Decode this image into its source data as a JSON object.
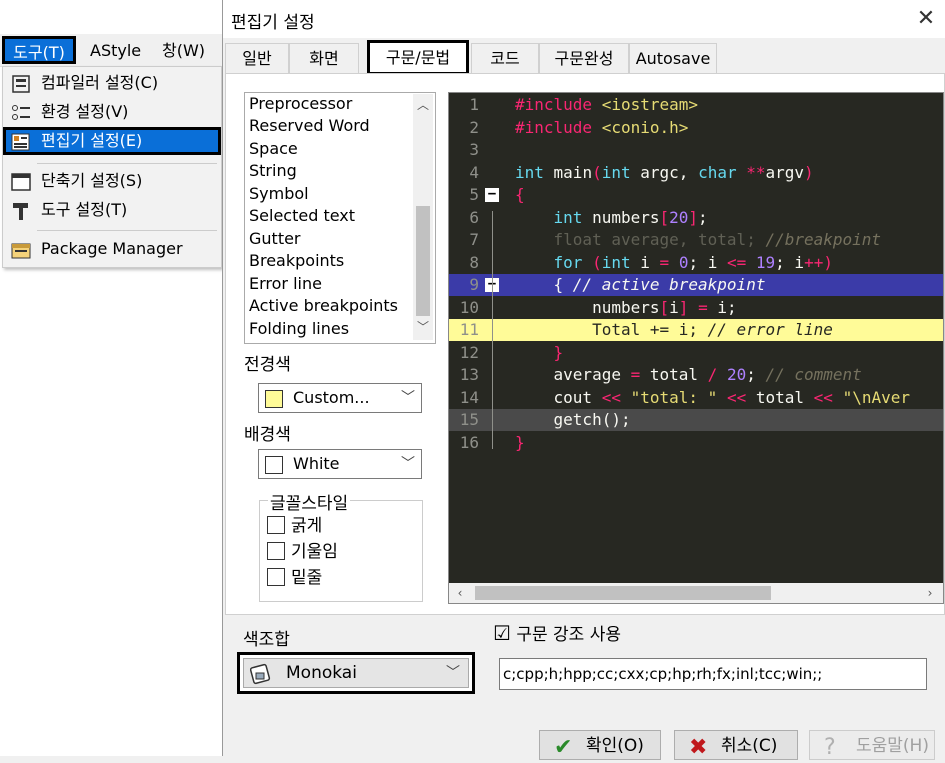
{
  "app": {
    "menu": {
      "tools": "도구(T)",
      "astyle": "AStyle",
      "window": "창(W)"
    },
    "dropdown": {
      "compiler": "컴파일러 설정(C)",
      "environment": "환경 설정(V)",
      "editor": "편집기 설정(E)",
      "shortcuts": "단축기 설정(S)",
      "tools": "도구 설정(T)",
      "package_manager": "Package Manager"
    }
  },
  "dialog": {
    "title": "편집기 설정",
    "close": "✕",
    "tabs": {
      "general": "일반",
      "display": "화면",
      "syntax": "구문/문법",
      "code": "코드",
      "completion": "구문완성",
      "autosave": "Autosave"
    },
    "elements": [
      "Preprocessor",
      "Reserved Word",
      "Space",
      "String",
      "Symbol",
      "Selected text",
      "Gutter",
      "Breakpoints",
      "Error line",
      "Active breakpoints",
      "Folding lines"
    ],
    "foreground_label": "전경색",
    "foreground_value": "Custom...",
    "foreground_color": "#fffb98",
    "background_label": "배경색",
    "background_value": "White",
    "background_color": "#ffffff",
    "font_style_label": "글꼴스타일",
    "font_style": {
      "bold": "굵게",
      "italic": "기울임",
      "underline": "밑줄"
    },
    "scheme_label": "색조합",
    "scheme_value": "Monokai",
    "syntax_highlight": {
      "checked": "☑",
      "label": "구문 강조 사용"
    },
    "extensions": "c;cpp;h;hpp;cc;cxx;cp;hp;rh;fx;inl;tcc;win;;",
    "buttons": {
      "ok": "확인(O)",
      "cancel": "취소(C)",
      "help": "도움말(H)"
    }
  },
  "preview": {
    "colors": {
      "background": "#272822",
      "active_breakpoint": "#3b3ba8",
      "error_line": "#fffb98",
      "gray_line": "#4a4a4a"
    },
    "line_numbers": [
      "1",
      "2",
      "3",
      "4",
      "5",
      "6",
      "7",
      "8",
      "9",
      "10",
      "11",
      "12",
      "13",
      "14",
      "15",
      "16"
    ],
    "lines": [
      [
        [
          "pp",
          "#include "
        ],
        [
          "str",
          "<iostream>"
        ]
      ],
      [
        [
          "pp",
          "#include "
        ],
        [
          "str",
          "<conio.h>"
        ]
      ],
      [],
      [
        [
          "kw",
          "int"
        ],
        [
          "pl",
          " main"
        ],
        [
          "op",
          "("
        ],
        [
          "kw",
          "int"
        ],
        [
          "pl",
          " argc, "
        ],
        [
          "kw",
          "char"
        ],
        [
          "pl",
          " "
        ],
        [
          "op",
          "**"
        ],
        [
          "pl",
          "argv"
        ],
        [
          "op",
          ")"
        ]
      ],
      [
        [
          "op",
          "{"
        ]
      ],
      [
        [
          "pl",
          "    "
        ],
        [
          "kw",
          "int"
        ],
        [
          "pl",
          " numbers"
        ],
        [
          "op",
          "["
        ],
        [
          "num",
          "20"
        ],
        [
          "op",
          "]"
        ],
        [
          "pl",
          ";"
        ]
      ],
      [
        [
          "pl",
          "    float average, total; "
        ],
        [
          "cm",
          "//breakpoint"
        ]
      ],
      [
        [
          "pl",
          "    "
        ],
        [
          "kw",
          "for"
        ],
        [
          "pl",
          " "
        ],
        [
          "op",
          "("
        ],
        [
          "kw",
          "int"
        ],
        [
          "pl",
          " i "
        ],
        [
          "op",
          "="
        ],
        [
          "pl",
          " "
        ],
        [
          "num",
          "0"
        ],
        [
          "pl",
          "; i "
        ],
        [
          "op",
          "<="
        ],
        [
          "pl",
          " "
        ],
        [
          "num",
          "19"
        ],
        [
          "pl",
          "; i"
        ],
        [
          "op",
          "++)"
        ]
      ],
      [
        [
          "pl",
          "    { "
        ],
        [
          "cmw",
          "// active breakpoint"
        ]
      ],
      [
        [
          "pl",
          "        numbers"
        ],
        [
          "op",
          "["
        ],
        [
          "pl",
          "i"
        ],
        [
          "op",
          "]"
        ],
        [
          "pl",
          " "
        ],
        [
          "op",
          "="
        ],
        [
          "pl",
          " i;"
        ]
      ],
      [
        [
          "dk",
          "        Total += i; "
        ],
        [
          "dki",
          "// error line"
        ]
      ],
      [
        [
          "pl",
          "    "
        ],
        [
          "op",
          "}"
        ]
      ],
      [
        [
          "pl",
          "    average "
        ],
        [
          "op",
          "="
        ],
        [
          "pl",
          " total "
        ],
        [
          "op",
          "/"
        ],
        [
          "pl",
          " "
        ],
        [
          "num",
          "20"
        ],
        [
          "pl",
          "; "
        ],
        [
          "cm",
          "// comment"
        ]
      ],
      [
        [
          "pl",
          "    cout "
        ],
        [
          "op",
          "<<"
        ],
        [
          "pl",
          " "
        ],
        [
          "str",
          "\"total: \""
        ],
        [
          "pl",
          " "
        ],
        [
          "op",
          "<<"
        ],
        [
          "pl",
          " total "
        ],
        [
          "op",
          "<<"
        ],
        [
          "pl",
          " "
        ],
        [
          "str",
          "\"\\nAver"
        ]
      ],
      [
        [
          "pl",
          "    getch();"
        ]
      ],
      [
        [
          "op",
          "}"
        ]
      ]
    ]
  }
}
